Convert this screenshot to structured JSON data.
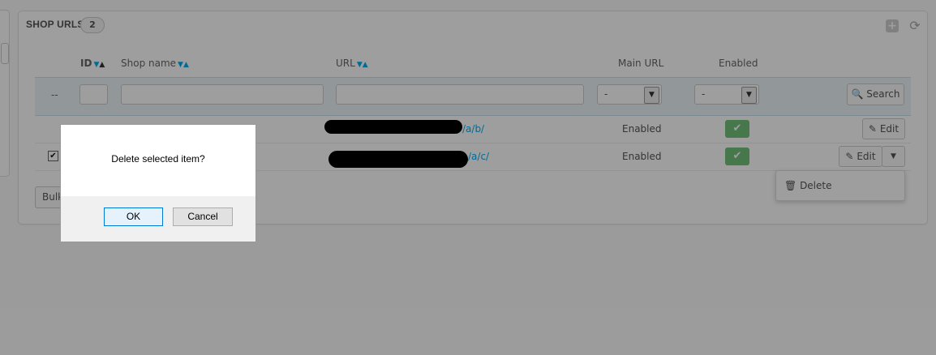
{
  "panel": {
    "title": "SHOP URLS",
    "count": "2"
  },
  "columns": {
    "id": "ID",
    "shop_name": "Shop name",
    "url": "URL",
    "main_url": "Main URL",
    "enabled": "Enabled"
  },
  "filters": {
    "dash": "--",
    "main_url_value": "-",
    "enabled_value": "-",
    "search_label": "Search"
  },
  "rows": [
    {
      "url": "/a/b/",
      "main_url": "Enabled",
      "edit_label": "Edit",
      "checked": false
    },
    {
      "url": "/a/c/",
      "main_url": "Enabled",
      "edit_label": "Edit",
      "checked": true
    }
  ],
  "dropdown": {
    "delete_label": "Delete"
  },
  "bulk": {
    "label": "Bulk"
  },
  "dialog": {
    "message": "Delete selected item?",
    "ok_label": "OK",
    "cancel_label": "Cancel"
  },
  "colors": {
    "accent": "#00aff0",
    "enabled": "#72c279"
  },
  "icons": {
    "search": "search-icon",
    "edit": "pencil-icon",
    "delete": "trash-icon",
    "check": "check-icon"
  }
}
